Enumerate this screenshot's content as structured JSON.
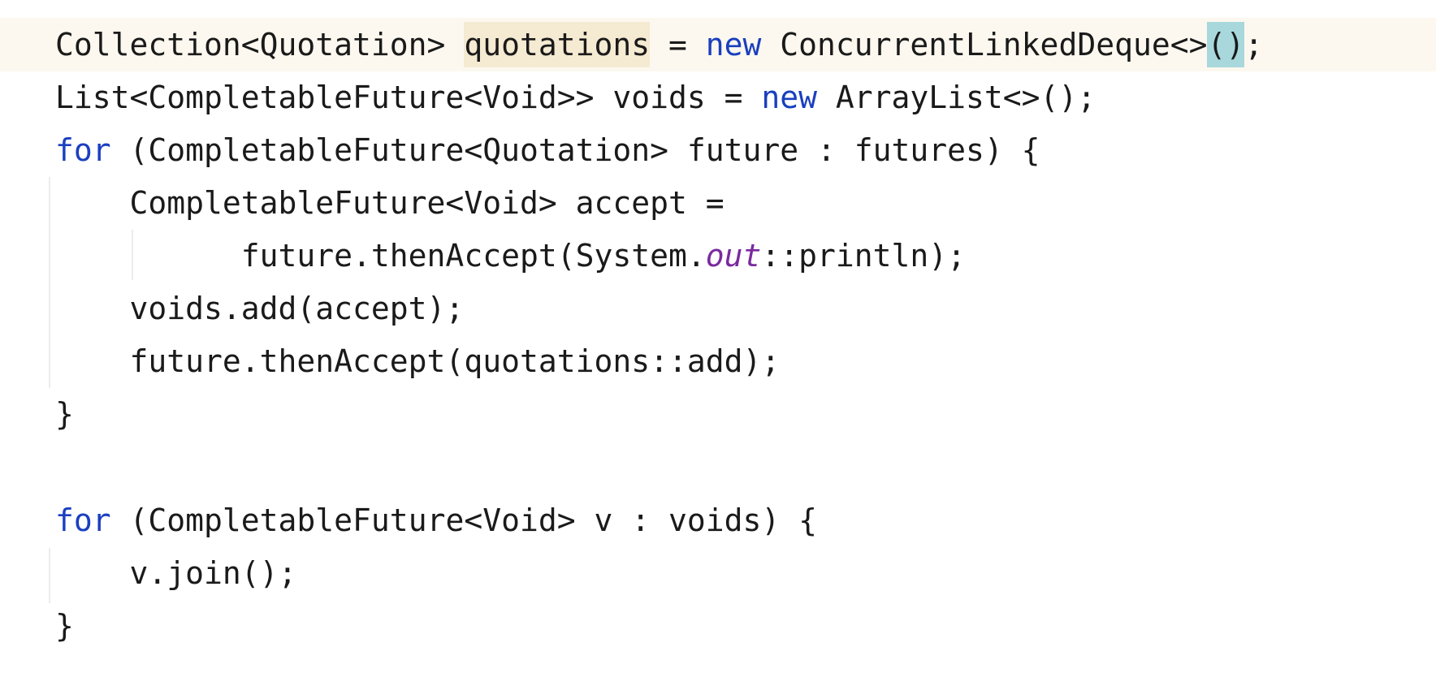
{
  "editor": {
    "line1": {
      "type_decl": "Collection<Quotation> ",
      "var": "quotations",
      "eq": " = ",
      "kw": "new",
      "ctor": " ConcurrentLinkedDeque<>",
      "paren_open": "(",
      "paren_close": ")",
      "end": ";"
    },
    "line2": {
      "a": "List<CompletableFuture<Void>> voids = ",
      "kw": "new",
      "b": " ArrayList<>();"
    },
    "line3": {
      "kw": "for",
      "rest": " (CompletableFuture<Quotation> future : futures) {"
    },
    "line4": {
      "text": "    CompletableFuture<Void> accept ="
    },
    "line5": {
      "a": "          future.thenAccept(System.",
      "static_field": "out",
      "b": "::println);"
    },
    "line6": {
      "text": "    voids.add(accept);"
    },
    "line7": {
      "text": "    future.thenAccept(quotations::add);"
    },
    "line8": {
      "text": "}"
    },
    "line10": {
      "kw": "for",
      "rest": " (CompletableFuture<Void> v : voids) {"
    },
    "line11": {
      "text": "    v.join();"
    },
    "line12": {
      "text": "}"
    }
  },
  "colors": {
    "keyword": "#1a3fbf",
    "static_field": "#7a2a9f",
    "current_line_bg": "#fcf8ef",
    "occurrence_highlight": "#f5ead2",
    "bracket_match": "#a8d8dc"
  }
}
